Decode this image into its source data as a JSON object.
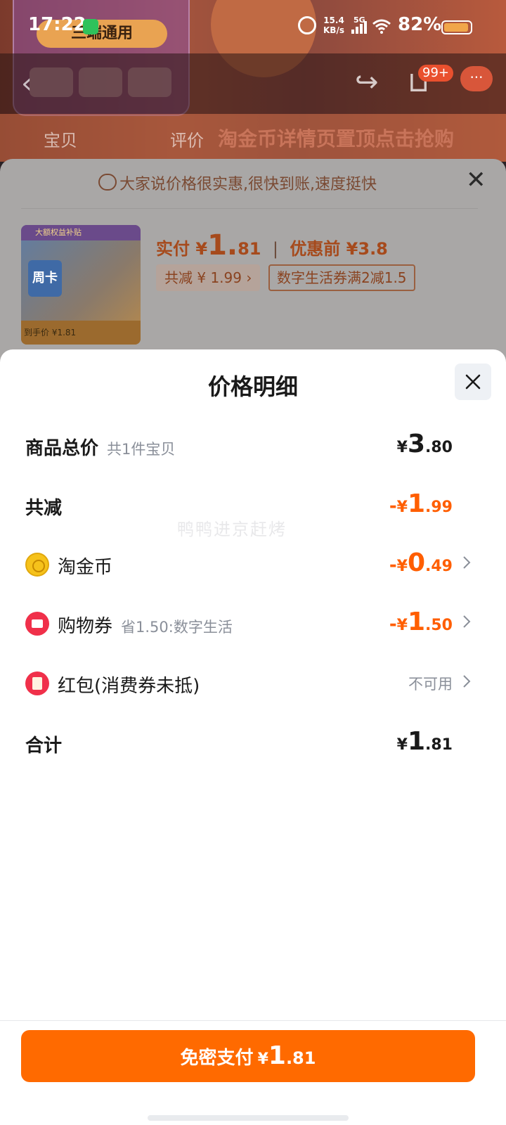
{
  "status_bar": {
    "time": "17:22",
    "net_speed_value": "15.4",
    "net_speed_unit": "KB/s",
    "network": "5G",
    "battery": "82%"
  },
  "background": {
    "art_pill": "三端通用",
    "nav_badge": "99+",
    "tab_baobei": "宝贝",
    "tab_pingjia": "评价",
    "banner_text": "淘金币详情页置顶点击抢购"
  },
  "order_panel": {
    "review_text": "大家说价格很实惠,很快到账,速度挺快",
    "thumb_head": "大额权益补贴",
    "thumb_card": "周卡",
    "thumb_foot": "到手价 ¥1.81",
    "paid_label": "实付",
    "paid_yen": "¥",
    "paid_int": "1.",
    "paid_dec": "81",
    "before_label": "优惠前 ¥3.8",
    "reduce_chip": "共减 ¥ 1.99 ›",
    "coupon_chip": "数字生活券满2减1.5"
  },
  "sheet": {
    "title": "价格明细",
    "watermark": "鸭鸭进京赶烤",
    "rows": {
      "total": {
        "label": "商品总价",
        "sub": "共1件宝贝",
        "yen": "¥",
        "int": "3",
        "dec": ".80"
      },
      "reduce": {
        "label": "共减",
        "minus": "-",
        "yen": "¥",
        "int": "1",
        "dec": ".99"
      },
      "coin": {
        "label": "淘金币",
        "minus": "-",
        "yen": "¥",
        "int": "0",
        "dec": ".49"
      },
      "coupon": {
        "label": "购物券",
        "sub": "省1.50:数字生活",
        "minus": "-",
        "yen": "¥",
        "int": "1",
        "dec": ".50"
      },
      "hongbao": {
        "label": "红包(消费券未抵)",
        "status": "不可用"
      },
      "sum": {
        "label": "合计",
        "yen": "¥",
        "int": "1",
        "dec": ".81"
      }
    },
    "pay_button": {
      "label": "免密支付",
      "yen": "¥",
      "int": "1",
      "dec": ".81"
    }
  },
  "colors": {
    "accent_orange": "#ff6a00",
    "discount_orange": "#ff5e00",
    "muted_text": "#8a8f99"
  }
}
